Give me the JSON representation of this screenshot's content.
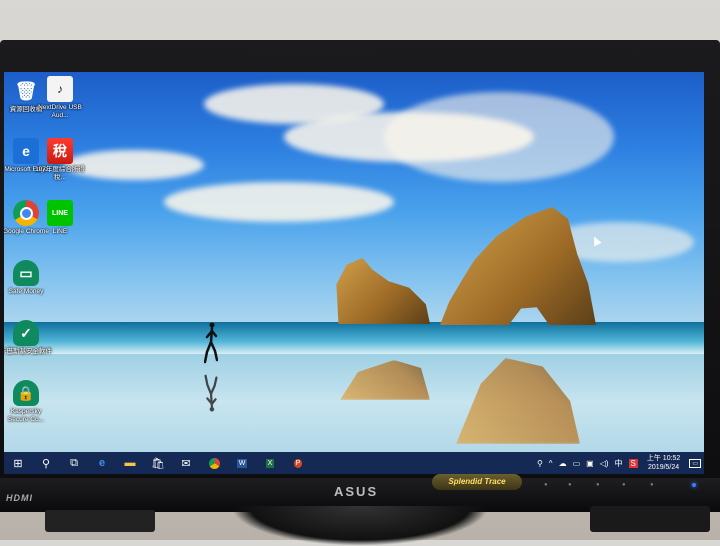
{
  "bezel": {
    "left_label": "HDMI",
    "brand": "ASUS",
    "splendid_badge": "Splendid Trace"
  },
  "desktop": {
    "icons": [
      {
        "label": "資源回收桶",
        "icon": "recycle-bin-icon"
      },
      {
        "label": "NextDrive USB Aud...",
        "icon": "nextdrive-icon"
      },
      {
        "label": "Microsoft Edge",
        "icon": "edge-icon"
      },
      {
        "label": "107年度綜合所得稅...",
        "icon": "tax-app-icon"
      },
      {
        "label": "Google Chrome",
        "icon": "chrome-icon"
      },
      {
        "label": "LINE",
        "icon": "line-icon"
      },
      {
        "label": "Safe Money",
        "icon": "safe-money-icon"
      },
      {
        "label": "卡巴斯基安全軟件",
        "icon": "kaspersky-shield-icon"
      },
      {
        "label": "Kaspersky Secure Co...",
        "icon": "kaspersky-vpn-icon"
      }
    ]
  },
  "taskbar": {
    "pinned": [
      "start-icon",
      "search-icon",
      "task-view-icon",
      "edge-icon",
      "file-explorer-icon",
      "store-icon",
      "mail-icon",
      "chrome-icon",
      "word-icon",
      "excel-icon",
      "powerpoint-icon"
    ],
    "tray": {
      "ime_mode": "中",
      "ime_letter": "S",
      "time": "上午 10:52",
      "date": "2019/5/24"
    }
  },
  "colors": {
    "taskbar": "#142a55",
    "sky_top": "#1d5ec9",
    "bezel": "#0d0d0f"
  }
}
